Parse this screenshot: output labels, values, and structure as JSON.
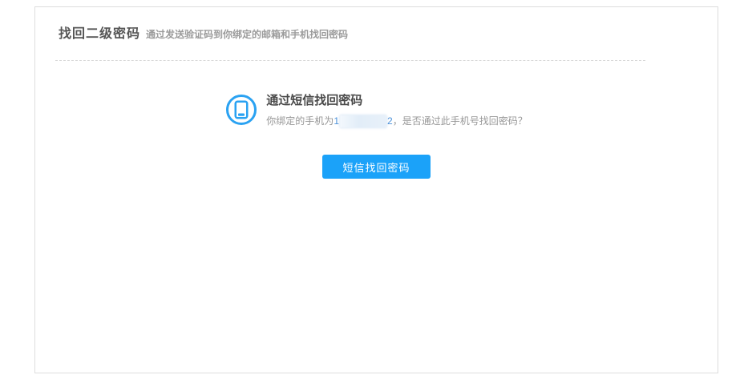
{
  "header": {
    "title": "找回二级密码",
    "subtitle": "通过发送验证码到你绑定的邮箱和手机找回密码"
  },
  "sms_option": {
    "icon": "smartphone-icon",
    "title": "通过短信找回密码",
    "desc_prefix": "你绑定的手机为",
    "phone_visible_start": "1",
    "phone_middle": "redacted",
    "phone_visible_end": "2",
    "desc_suffix": "，是否通过此手机号找回密码？",
    "button_label": "短信找回密码"
  },
  "colors": {
    "accent_blue": "#1ba2f9",
    "icon_blue": "#2aa2f2",
    "phone_digit_blue": "#4a90d9",
    "card_border": "#dddddd",
    "title_text": "#555555",
    "secondary_text": "#999999"
  }
}
